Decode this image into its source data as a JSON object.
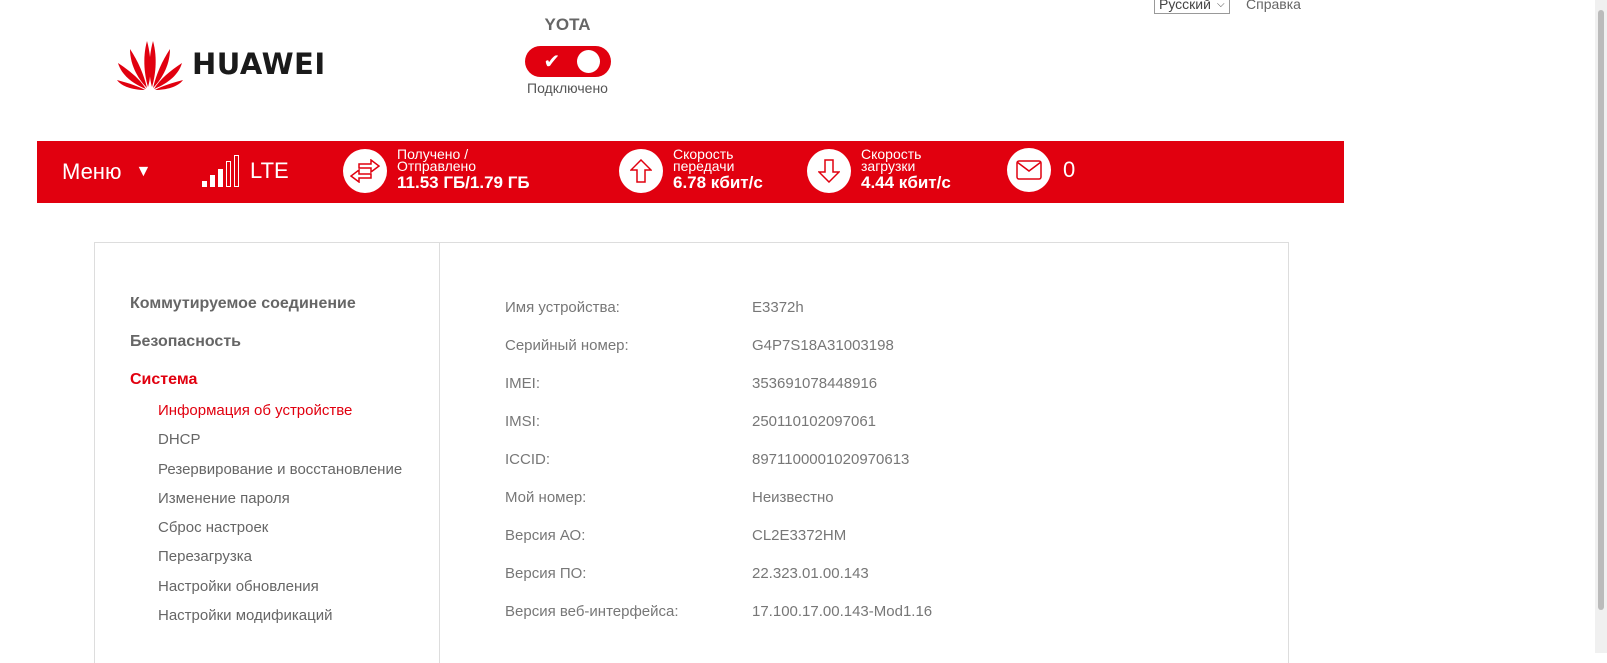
{
  "brand": {
    "name": "HUAWEI",
    "color": "#e1000f"
  },
  "connection": {
    "carrier": "YOTA",
    "status": "Подключено",
    "toggle_on": true
  },
  "top_links": {
    "language": "Русский",
    "help": "Справка"
  },
  "statusbar": {
    "menu_label": "Меню",
    "signal_bars_filled": 3,
    "signal_bars_total": 5,
    "network_type": "LTE",
    "traffic_label_1": "Получено /",
    "traffic_label_2": "Отправлено",
    "traffic_value": "11.53 ГБ/1.79 ГБ",
    "upload_label_1": "Скорость",
    "upload_label_2": "передачи",
    "upload_value": "6.78 кбит/с",
    "download_label_1": "Скорость",
    "download_label_2": "загрузки",
    "download_value": "4.44 кбит/с",
    "messages_count": "0"
  },
  "sidebar": {
    "sections": [
      {
        "label": "Коммутируемое соединение"
      },
      {
        "label": "Безопасность"
      },
      {
        "label": "Система"
      }
    ],
    "items": [
      {
        "label": "Информация об устройстве"
      },
      {
        "label": "DHCP"
      },
      {
        "label": "Резервирование и восстановление"
      },
      {
        "label": "Изменение пароля"
      },
      {
        "label": "Сброс настроек"
      },
      {
        "label": "Перезагрузка"
      },
      {
        "label": "Настройки обновления"
      },
      {
        "label": "Настройки модификаций"
      }
    ]
  },
  "device_info": [
    {
      "key": "Имя устройства:",
      "value": "E3372h"
    },
    {
      "key": "Серийный номер:",
      "value": "G4P7S18A31003198"
    },
    {
      "key": "IMEI:",
      "value": "353691078448916"
    },
    {
      "key": "IMSI:",
      "value": "250110102097061"
    },
    {
      "key": "ICCID:",
      "value": "8971100001020970613"
    },
    {
      "key": "Мой номер:",
      "value": "Неизвестно"
    },
    {
      "key": "Версия АО:",
      "value": "CL2E3372HM"
    },
    {
      "key": "Версия ПО:",
      "value": "22.323.01.00.143"
    },
    {
      "key": "Версия веб-интерфейса:",
      "value": "17.100.17.00.143-Mod1.16"
    }
  ]
}
